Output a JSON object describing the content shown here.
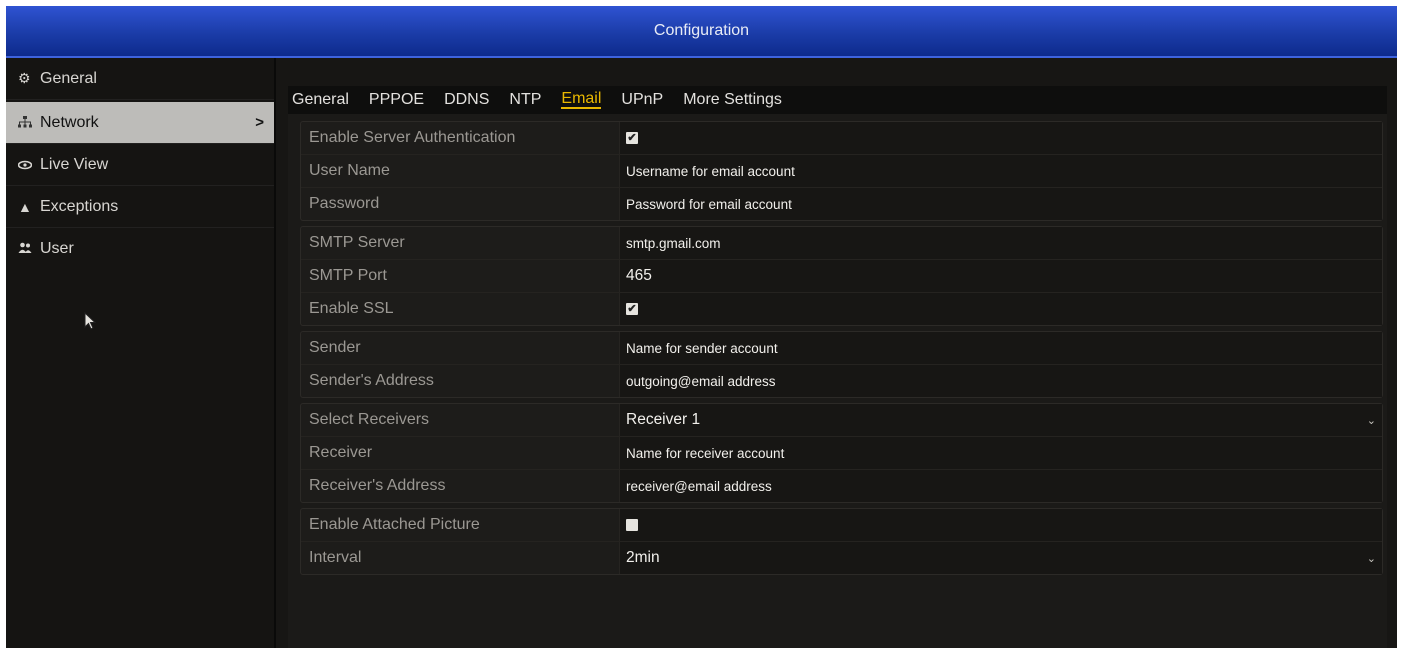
{
  "window": {
    "title": "Configuration"
  },
  "sidebar": {
    "items": [
      {
        "label": "General",
        "icon": "gear-icon"
      },
      {
        "label": "Network",
        "icon": "network-icon",
        "active": true,
        "chevron": ">"
      },
      {
        "label": "Live View",
        "icon": "eye-icon"
      },
      {
        "label": "Exceptions",
        "icon": "warning-icon"
      },
      {
        "label": "User",
        "icon": "users-icon"
      }
    ]
  },
  "tabs": [
    "General",
    "PPPOE",
    "DDNS",
    "NTP",
    "Email",
    "UPnP",
    "More Settings"
  ],
  "active_tab": "Email",
  "form": {
    "enable_server_auth": {
      "label": "Enable Server Authentication",
      "checked": true,
      "mark": "✔"
    },
    "user_name": {
      "label": "User Name",
      "value": "Username for email account"
    },
    "password": {
      "label": "Password",
      "value": "Password for email account"
    },
    "smtp_server": {
      "label": "SMTP Server",
      "value": "smtp.gmail.com"
    },
    "smtp_port": {
      "label": "SMTP Port",
      "value": "465"
    },
    "enable_ssl": {
      "label": "Enable SSL",
      "checked": true,
      "mark": "✔"
    },
    "sender": {
      "label": "Sender",
      "value": "Name for sender account"
    },
    "sender_address": {
      "label": "Sender's Address",
      "value": "outgoing@email address"
    },
    "select_receivers": {
      "label": "Select Receivers",
      "value": "Receiver 1",
      "arrow": "⌄"
    },
    "receiver": {
      "label": "Receiver",
      "value": "Name for receiver account"
    },
    "receiver_address": {
      "label": "Receiver's Address",
      "value": "receiver@email address"
    },
    "enable_attached_picture": {
      "label": "Enable Attached Picture",
      "checked": false,
      "mark": ""
    },
    "interval": {
      "label": "Interval",
      "value": "2min",
      "arrow": "⌄"
    }
  },
  "colors": {
    "title_bar": "#1b3ca8",
    "active_tab": "#e8b700",
    "background": "#171614"
  }
}
